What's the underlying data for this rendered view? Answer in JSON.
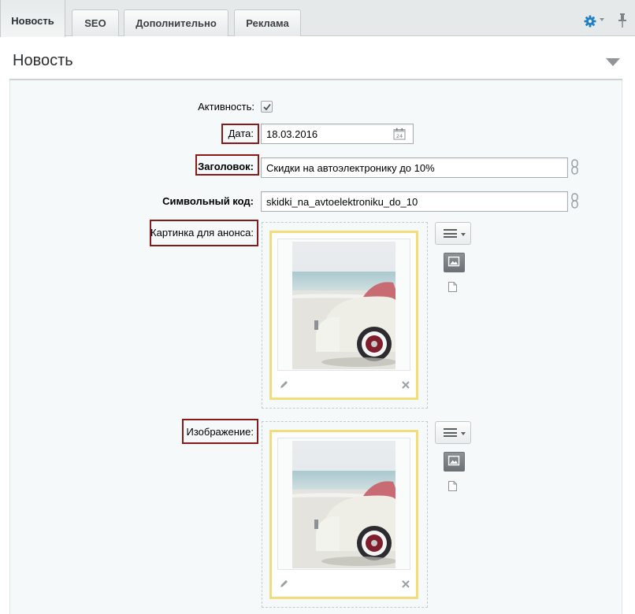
{
  "tabs": [
    {
      "label": "Новость",
      "active": true
    },
    {
      "label": "SEO",
      "active": false
    },
    {
      "label": "Дополнительно",
      "active": false
    },
    {
      "label": "Реклама",
      "active": false
    }
  ],
  "toolbar": {
    "settings_icon": "gear-icon",
    "pin_icon": "pin-icon"
  },
  "section": {
    "title": "Новость"
  },
  "form": {
    "activity": {
      "label": "Активность:",
      "checked": true
    },
    "date": {
      "label": "Дата:",
      "value": "18.03.2016"
    },
    "title": {
      "label": "Заголовок:",
      "value": "Скидки на автоэлектронику до 10%"
    },
    "code": {
      "label": "Символьный код:",
      "value": "skidki_na_avtoelektroniku_do_10"
    },
    "preview_picture": {
      "label": "Картинка для анонса:"
    },
    "detail_picture": {
      "label": "Изображение:"
    }
  },
  "colors": {
    "accent": "#1e7fc4",
    "highlight_border": "#8a1a1a",
    "card_border": "#f3dc7a"
  }
}
